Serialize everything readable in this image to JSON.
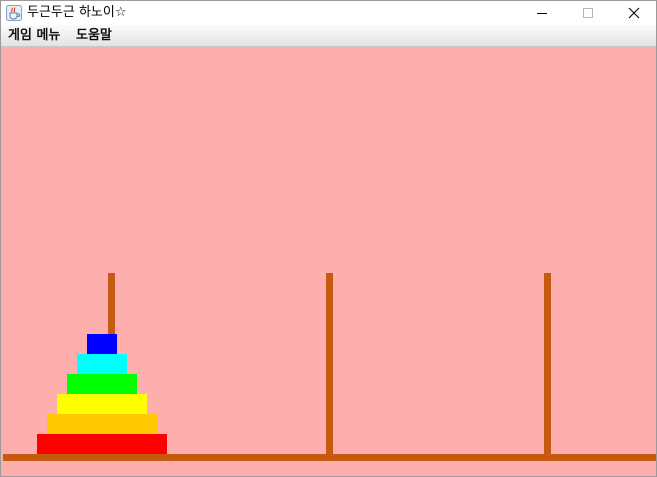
{
  "window": {
    "title": "두근두근 하노이☆",
    "icon": "java-cup-icon"
  },
  "menubar": {
    "items": [
      {
        "label": "게임 메뉴"
      },
      {
        "label": "도움말"
      }
    ]
  },
  "game": {
    "background": "#ffaeae",
    "rod_color": "#c55a11",
    "peg_count": 3,
    "pegs": [
      {
        "disks": [
          {
            "size": 6,
            "color": "#ff0000"
          },
          {
            "size": 5,
            "color": "#ffc800"
          },
          {
            "size": 4,
            "color": "#ffff00"
          },
          {
            "size": 3,
            "color": "#00ff00"
          },
          {
            "size": 2,
            "color": "#00ffff"
          },
          {
            "size": 1,
            "color": "#0000ff"
          }
        ]
      },
      {
        "disks": []
      },
      {
        "disks": []
      }
    ]
  }
}
